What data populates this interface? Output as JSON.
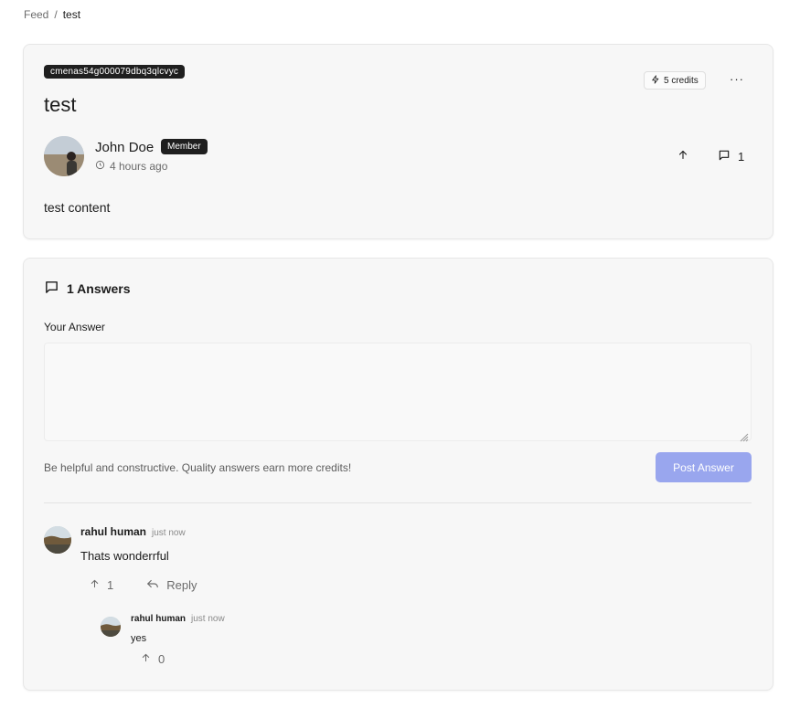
{
  "breadcrumb": {
    "root": "Feed",
    "separator": "/",
    "current": "test"
  },
  "post": {
    "id_badge": "cmenas54g000079dbq3qlcvyc",
    "title": "test",
    "credits": "5 credits",
    "more_icon": "···",
    "author": {
      "name": "John Doe",
      "role": "Member",
      "time": "4 hours ago"
    },
    "comment_count": "1",
    "content": "test content"
  },
  "answers": {
    "heading": "1 Answers",
    "your_answer_label": "Your Answer",
    "textarea_value": "",
    "helper_text": "Be helpful and constructive. Quality answers earn more credits!",
    "post_button": "Post Answer",
    "items": [
      {
        "author": "rahul human",
        "time": "just now",
        "text": "Thats wonderrful",
        "upvotes": "1",
        "reply_label": "Reply",
        "replies": [
          {
            "author": "rahul human",
            "time": "just now",
            "text": "yes",
            "upvotes": "0"
          }
        ]
      }
    ]
  },
  "colors": {
    "accent": "#99a6ee",
    "badge_bg": "#1f1f1f",
    "card_bg": "#f7f7f7"
  },
  "icons": [
    "zap-icon",
    "more-icon",
    "clock-icon",
    "arrow-up-icon",
    "message-square-icon",
    "reply-icon",
    "resize-handle-icon"
  ]
}
